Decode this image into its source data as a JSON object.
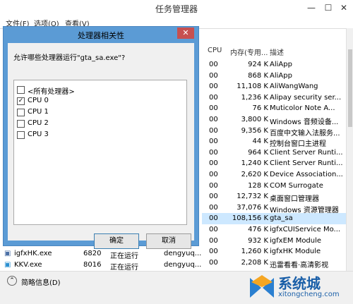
{
  "taskmgr": {
    "title": "任务管理器",
    "menu": [
      "文件(F)",
      "选项(O)",
      "查看(V)"
    ],
    "headers": {
      "cpu": "CPU",
      "mem": "内存(专用...",
      "desc": "描述"
    },
    "rows": [
      {
        "cpu": "00",
        "mem": "924 K",
        "desc": "AliApp"
      },
      {
        "cpu": "00",
        "mem": "868 K",
        "desc": "AliApp"
      },
      {
        "cpu": "00",
        "mem": "11,108 K",
        "desc": "AliWangWang"
      },
      {
        "cpu": "00",
        "mem": "1,236 K",
        "desc": "Alipay security ser..."
      },
      {
        "cpu": "00",
        "mem": "76 K",
        "desc": "Muticolor Note A..."
      },
      {
        "cpu": "00",
        "mem": "3,800 K",
        "desc": "Windows 音频设备..."
      },
      {
        "cpu": "00",
        "mem": "9,356 K",
        "desc": "百度中文输入法服务..."
      },
      {
        "cpu": "00",
        "mem": "44 K",
        "desc": "控制台窗口主进程"
      },
      {
        "cpu": "00",
        "mem": "964 K",
        "desc": "Client Server Runti..."
      },
      {
        "cpu": "00",
        "mem": "1,240 K",
        "desc": "Client Server Runti..."
      },
      {
        "cpu": "00",
        "mem": "2,620 K",
        "desc": "Device Association..."
      },
      {
        "cpu": "00",
        "mem": "128 K",
        "desc": "COM Surrogate"
      },
      {
        "cpu": "00",
        "mem": "12,732 K",
        "desc": "桌面窗口管理器"
      },
      {
        "cpu": "00",
        "mem": "37,076 K",
        "desc": "Windows 资源管理器"
      },
      {
        "cpu": "00",
        "mem": "108,156 K",
        "desc": "gta_sa"
      },
      {
        "cpu": "00",
        "mem": "476 K",
        "desc": "igfxCUIService Mo..."
      },
      {
        "cpu": "00",
        "mem": "932 K",
        "desc": "igfxEM Module"
      },
      {
        "cpu": "00",
        "mem": "1,260 K",
        "desc": "igfxHK Module"
      },
      {
        "cpu": "00",
        "mem": "2,208 K",
        "desc": "迅雷看看·高清影视"
      }
    ],
    "left_rows": [
      {
        "name": "igfxHK.exe",
        "pid": "6820",
        "status": "正在运行",
        "user": "dengyuq..."
      },
      {
        "name": "KKV.exe",
        "pid": "8016",
        "status": "正在运行",
        "user": "dengyuq..."
      }
    ],
    "footer": "简略信息(D)"
  },
  "dialog": {
    "title": "处理器相关性",
    "prompt": "允许哪些处理器运行\"gta_sa.exe\"?",
    "items": [
      {
        "label": "<所有处理器>",
        "checked": false
      },
      {
        "label": "CPU 0",
        "checked": true
      },
      {
        "label": "CPU 1",
        "checked": false
      },
      {
        "label": "CPU 2",
        "checked": false
      },
      {
        "label": "CPU 3",
        "checked": false
      }
    ],
    "ok": "确定",
    "cancel": "取消",
    "close": "✕"
  },
  "watermark": {
    "brand": "系统城",
    "url": "xitongcheng.com"
  }
}
